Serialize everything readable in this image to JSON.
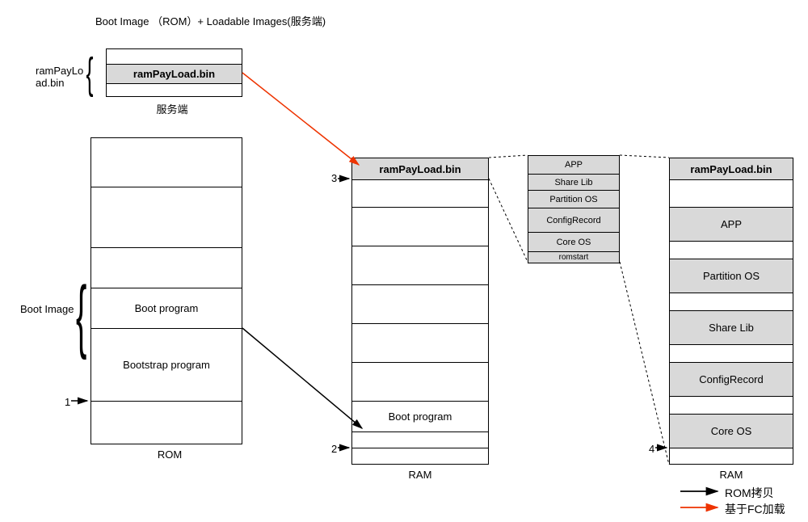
{
  "title": "Boot Image （ROM）+ Loadable Images(服务端)",
  "server_block": {
    "label": "ramPayLo\nad.bin",
    "content": "ramPayLoad.bin",
    "caption": "服务端"
  },
  "rom_block": {
    "label": "Boot Image",
    "rows": {
      "boot_program": "Boot program",
      "bootstrap_program": "Bootstrap program"
    },
    "caption": "ROM",
    "step1": "1"
  },
  "ram_block": {
    "rows": {
      "ram_payload": "ramPayLoad.bin",
      "boot_program": "Boot program"
    },
    "caption": "RAM",
    "step2": "2",
    "step3": "3"
  },
  "detail_block": {
    "rows": {
      "app": "APP",
      "share_lib": "Share Lib",
      "partition_os": "Partition OS",
      "config_record": "ConfigRecord",
      "core_os": "Core OS",
      "romstart": "romstart"
    }
  },
  "ram2_block": {
    "rows": {
      "ram_payload": "ramPayLoad.bin",
      "app": "APP",
      "partition_os": "Partition OS",
      "share_lib": "Share Lib",
      "config_record": "ConfigRecord",
      "core_os": "Core OS"
    },
    "caption": "RAM",
    "step4": "4"
  },
  "legend": {
    "rom_copy": "ROM拷贝",
    "fc_load": "基于FC加载"
  }
}
